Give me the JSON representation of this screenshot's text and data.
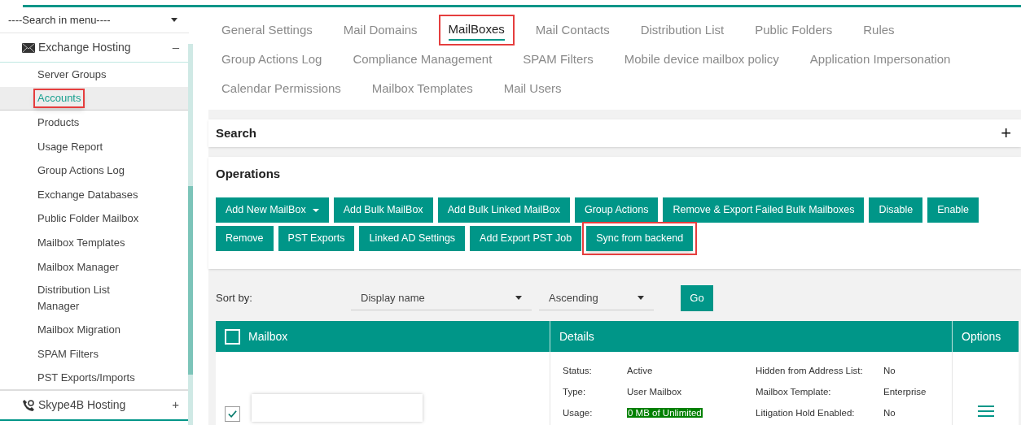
{
  "sidebar": {
    "search": {
      "placeholder": "----Search in menu----"
    },
    "groups": [
      {
        "label": "Exchange Hosting",
        "expanded": true,
        "toggle": "–",
        "items": [
          {
            "label": "Server Groups",
            "selected": false,
            "highlighted": false
          },
          {
            "label": "Accounts",
            "selected": true,
            "highlighted": true
          },
          {
            "label": "Products",
            "selected": false,
            "highlighted": false
          },
          {
            "label": "Usage Report",
            "selected": false,
            "highlighted": false
          },
          {
            "label": "Group Actions Log",
            "selected": false,
            "highlighted": false
          },
          {
            "label": "Exchange Databases",
            "selected": false,
            "highlighted": false
          },
          {
            "label": "Public Folder Mailbox",
            "selected": false,
            "highlighted": false
          },
          {
            "label": "Mailbox Templates",
            "selected": false,
            "highlighted": false
          },
          {
            "label": "Mailbox Manager",
            "selected": false,
            "highlighted": false
          },
          {
            "label": "Distribution List Manager",
            "selected": false,
            "highlighted": false
          },
          {
            "label": "Mailbox Migration",
            "selected": false,
            "highlighted": false
          },
          {
            "label": "SPAM Filters",
            "selected": false,
            "highlighted": false
          },
          {
            "label": "PST Exports/Imports",
            "selected": false,
            "highlighted": false
          }
        ]
      },
      {
        "label": "Skype4B Hosting",
        "expanded": false,
        "toggle": "+"
      }
    ]
  },
  "tabs": [
    [
      {
        "label": "General Settings",
        "selected": false,
        "highlighted": false
      },
      {
        "label": "Mail Domains",
        "selected": false,
        "highlighted": false
      },
      {
        "label": "MailBoxes",
        "selected": true,
        "highlighted": true
      },
      {
        "label": "Mail Contacts",
        "selected": false,
        "highlighted": false
      },
      {
        "label": "Distribution List",
        "selected": false,
        "highlighted": false
      },
      {
        "label": "Public Folders",
        "selected": false,
        "highlighted": false
      },
      {
        "label": "Rules",
        "selected": false,
        "highlighted": false
      }
    ],
    [
      {
        "label": "Group Actions Log",
        "selected": false,
        "highlighted": false
      },
      {
        "label": "Compliance Management",
        "selected": false,
        "highlighted": false
      },
      {
        "label": "SPAM Filters",
        "selected": false,
        "highlighted": false
      },
      {
        "label": "Mobile device mailbox policy",
        "selected": false,
        "highlighted": false
      },
      {
        "label": "Application Impersonation",
        "selected": false,
        "highlighted": false
      }
    ],
    [
      {
        "label": "Calendar Permissions",
        "selected": false,
        "highlighted": false
      },
      {
        "label": "Mailbox Templates",
        "selected": false,
        "highlighted": false
      },
      {
        "label": "Mail Users",
        "selected": false,
        "highlighted": false
      }
    ]
  ],
  "search_panel": {
    "title": "Search",
    "toggle": "+"
  },
  "operations": {
    "title": "Operations",
    "buttons": [
      [
        {
          "label": "Add New MailBox",
          "dropdown": true,
          "highlighted": false
        },
        {
          "label": "Add Bulk MailBox",
          "dropdown": false,
          "highlighted": false
        },
        {
          "label": "Add Bulk Linked MailBox",
          "dropdown": false,
          "highlighted": false
        },
        {
          "label": "Group Actions",
          "dropdown": false,
          "highlighted": false
        },
        {
          "label": "Remove & Export Failed Bulk Mailboxes",
          "dropdown": false,
          "highlighted": false
        },
        {
          "label": "Disable",
          "dropdown": false,
          "highlighted": false
        },
        {
          "label": "Enable",
          "dropdown": false,
          "highlighted": false
        }
      ],
      [
        {
          "label": "Remove",
          "dropdown": false,
          "highlighted": false
        },
        {
          "label": "PST Exports",
          "dropdown": false,
          "highlighted": false
        },
        {
          "label": "Linked AD Settings",
          "dropdown": false,
          "highlighted": false
        },
        {
          "label": "Add Export PST Job",
          "dropdown": false,
          "highlighted": false
        },
        {
          "label": "Sync from backend",
          "dropdown": false,
          "highlighted": true
        }
      ]
    ]
  },
  "sort": {
    "label": "Sort by:",
    "field": "Display name",
    "order": "Ascending",
    "button": "Go"
  },
  "table": {
    "select_all": false,
    "columns": [
      "Mailbox",
      "Details",
      "Options"
    ],
    "rows": [
      {
        "checked": true,
        "details": [
          [
            {
              "label": "Status:",
              "value": "Active",
              "kind": "text"
            },
            {
              "label": "Hidden from Address List:",
              "value": "No",
              "kind": "text"
            }
          ],
          [
            {
              "label": "Type:",
              "value": "User Mailbox",
              "kind": "text"
            },
            {
              "label": "Mailbox Template:",
              "value": "Enterprise",
              "kind": "text"
            }
          ],
          [
            {
              "label": "Usage:",
              "value": "0 MB of Unlimited",
              "kind": "usage"
            },
            {
              "label": "Litigation Hold Enabled:",
              "value": "No",
              "kind": "text"
            }
          ]
        ]
      }
    ]
  }
}
